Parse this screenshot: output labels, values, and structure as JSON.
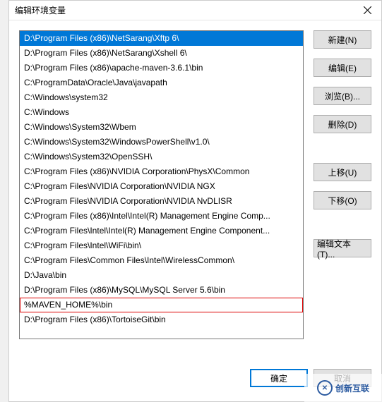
{
  "dialog": {
    "title": "编辑环境变量",
    "close_label": "Close"
  },
  "list": {
    "items": [
      {
        "text": "D:\\Program Files (x86)\\NetSarang\\Xftp 6\\",
        "selected": true
      },
      {
        "text": "D:\\Program Files (x86)\\NetSarang\\Xshell 6\\"
      },
      {
        "text": "D:\\Program Files (x86)\\apache-maven-3.6.1\\bin"
      },
      {
        "text": "C:\\ProgramData\\Oracle\\Java\\javapath"
      },
      {
        "text": "C:\\Windows\\system32"
      },
      {
        "text": "C:\\Windows"
      },
      {
        "text": "C:\\Windows\\System32\\Wbem"
      },
      {
        "text": "C:\\Windows\\System32\\WindowsPowerShell\\v1.0\\"
      },
      {
        "text": "C:\\Windows\\System32\\OpenSSH\\"
      },
      {
        "text": "C:\\Program Files (x86)\\NVIDIA Corporation\\PhysX\\Common"
      },
      {
        "text": "C:\\Program Files\\NVIDIA Corporation\\NVIDIA NGX"
      },
      {
        "text": "C:\\Program Files\\NVIDIA Corporation\\NVIDIA NvDLISR"
      },
      {
        "text": "C:\\Program Files (x86)\\Intel\\Intel(R) Management Engine Comp..."
      },
      {
        "text": "C:\\Program Files\\Intel\\Intel(R) Management Engine Component..."
      },
      {
        "text": "C:\\Program Files\\Intel\\WiFi\\bin\\"
      },
      {
        "text": "C:\\Program Files\\Common Files\\Intel\\WirelessCommon\\"
      },
      {
        "text": "D:\\Java\\bin"
      },
      {
        "text": "D:\\Program Files (x86)\\MySQL\\MySQL Server 5.6\\bin"
      },
      {
        "text": "%MAVEN_HOME%\\bin",
        "highlighted": true
      },
      {
        "text": "D:\\Program Files (x86)\\TortoiseGit\\bin"
      }
    ]
  },
  "buttons": {
    "new": "新建(N)",
    "edit": "编辑(E)",
    "browse": "浏览(B)...",
    "delete": "删除(D)",
    "moveup": "上移(U)",
    "movedown": "下移(O)",
    "edittext": "编辑文本(T)...",
    "ok": "确定",
    "cancel": "取消"
  },
  "watermark": {
    "text": "创新互联"
  }
}
